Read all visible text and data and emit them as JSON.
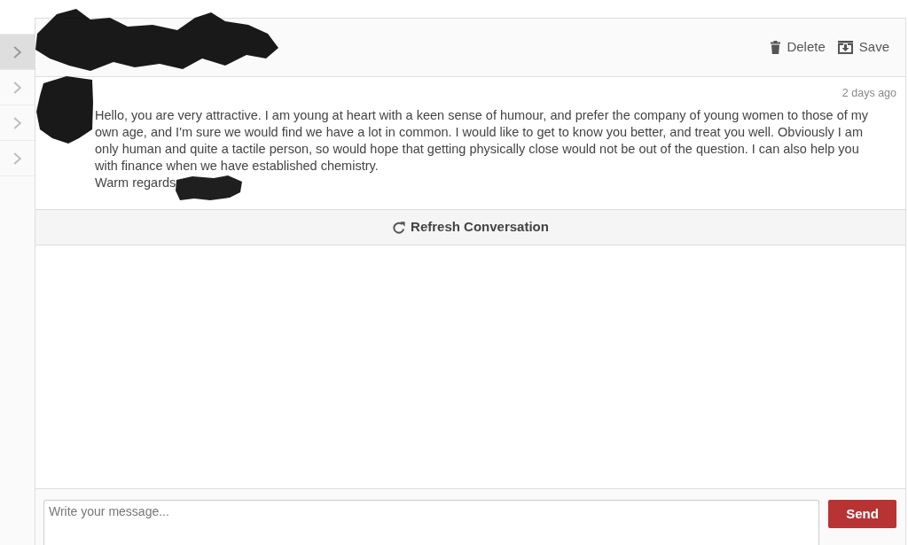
{
  "sidebar": {
    "items": [
      {
        "selected": true
      },
      {
        "selected": false
      },
      {
        "selected": false
      },
      {
        "selected": false
      }
    ]
  },
  "conversation": {
    "actions": [
      {
        "kind": "delete",
        "label": "Delete"
      },
      {
        "kind": "save",
        "label": "Save"
      }
    ],
    "message": {
      "time": "2 days ago",
      "body": "Hello, you are very attractive. I am young at heart with a keen sense of humour, and prefer the company of young women to those of my own age, and I'm sure we would find we have a lot in common. I would like to get to know you better, and treat you well. Obviously I am only human and quite a tactile person, so would hope that getting physically close would not be out of the question. I can also help you with finance when we have established chemistry.",
      "signoff": "Warm regards"
    },
    "refresh_button": "Refresh Conversation"
  },
  "composer": {
    "placeholder": "Write your message...",
    "send_button": "Send"
  }
}
